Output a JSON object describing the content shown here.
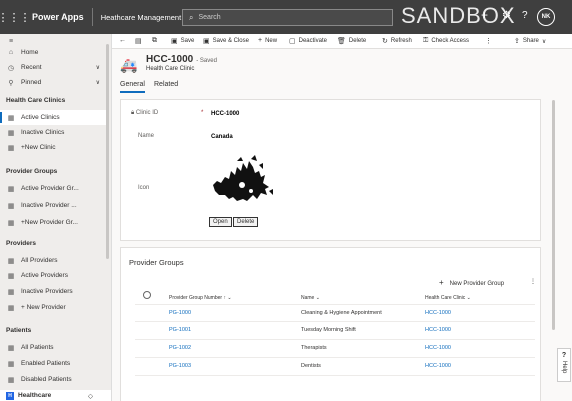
{
  "topbar": {
    "brand": "Power Apps",
    "app_name": "Heathcare Management",
    "search_placeholder": "Search",
    "environment": "SANDBOX",
    "user_initials": "NK"
  },
  "sidebar": {
    "nav": [
      {
        "label": "Home",
        "icon": "home-icon"
      },
      {
        "label": "Recent",
        "icon": "clock-icon"
      },
      {
        "label": "Pinned",
        "icon": "pin-icon"
      }
    ],
    "groups": [
      {
        "title": "Health Care Clinics",
        "items": [
          "Active Clinics",
          "Inactive Clinics",
          "+New Clinic"
        ]
      },
      {
        "title": "Provider Groups",
        "items": [
          "Active Provider Gr...",
          "Inactive Provider ...",
          "+New Provider Gr..."
        ]
      },
      {
        "title": "Providers",
        "items": [
          "All Providers",
          "Active Providers",
          "Inactive Providers",
          "+ New Provider"
        ]
      },
      {
        "title": "Patients",
        "items": [
          "All Patients",
          "Enabled Patients",
          "Disabled Patients"
        ]
      }
    ],
    "area_badge": "H",
    "area_label": "Healthcare"
  },
  "commands": [
    "Save",
    "Save & Close",
    "New",
    "Deactivate",
    "Delete",
    "Refresh",
    "Check Access",
    "Share"
  ],
  "record": {
    "title": "HCC-1000",
    "saved_label": "- Saved",
    "entity": "Health Care Clinic",
    "tabs": [
      "General",
      "Related"
    ]
  },
  "fields": {
    "clinic_id_label": "Clinic ID",
    "required_marker": "*",
    "clinic_id_value": "HCC-1000",
    "name_label": "Name",
    "name_value": "Canada",
    "icon_label": "Icon",
    "open_button": "Open",
    "delete_button": "Delete"
  },
  "provider_groups": {
    "title": "Provider Groups",
    "new_button": "New Provider Group",
    "columns": [
      "Provider Group Number ↑ ⌄",
      "Name ⌄",
      "Health Care Clinic ⌄"
    ],
    "rows": [
      [
        "PG-1000",
        "Cleaning & Hygiene Appointment",
        "HCC-1000"
      ],
      [
        "PG-1001",
        "Tuesday Morning Shift",
        "HCC-1000"
      ],
      [
        "PG-1002",
        "Therapists",
        "HCC-1000"
      ],
      [
        "PG-1003",
        "Dentists",
        "HCC-1000"
      ]
    ]
  },
  "help": {
    "label": "Help"
  }
}
